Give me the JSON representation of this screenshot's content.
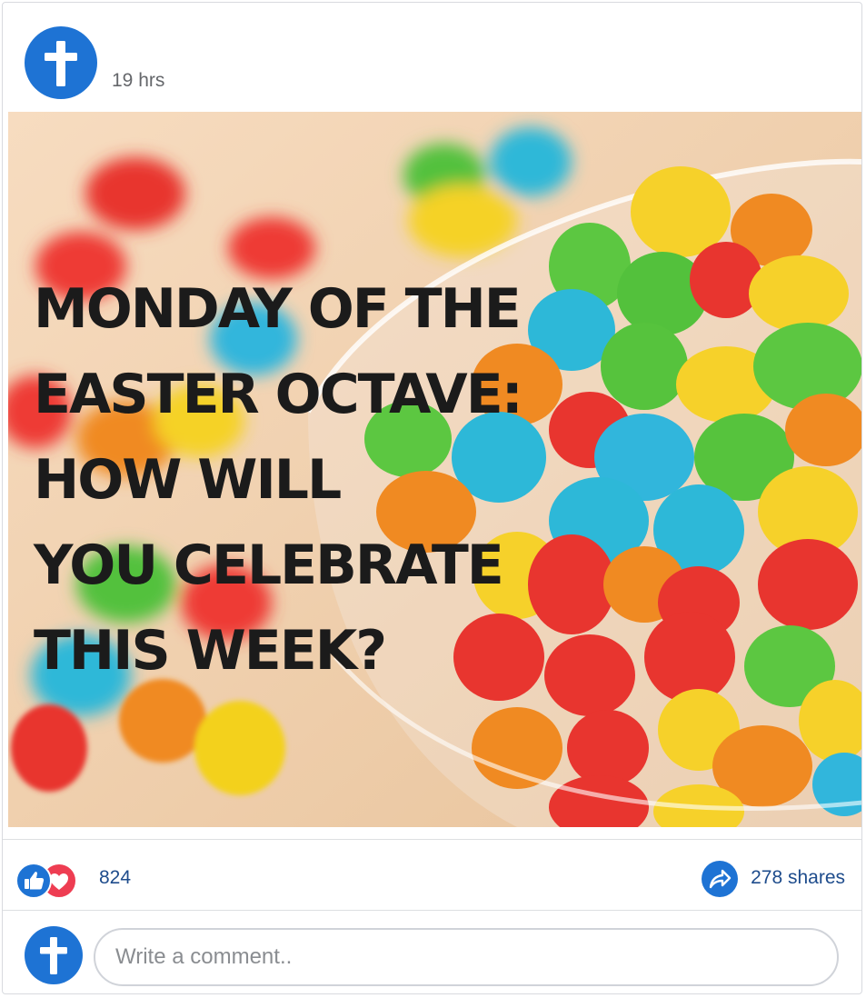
{
  "post": {
    "author_avatar_icon": "cross-icon",
    "timestamp": "19 hrs",
    "image": {
      "headline_lines": [
        "MONDAY OF THE",
        "EASTER OCTAVE:",
        "HOW WILL",
        "YOU CELEBRATE",
        "THIS WEEK?"
      ],
      "description": "bowl of colorful jelly beans"
    },
    "reactions": {
      "icons": [
        "thumbs-up-icon",
        "heart-icon"
      ],
      "count": "824"
    },
    "shares": {
      "icon": "share-arrow-icon",
      "label": "278 shares"
    }
  },
  "comment": {
    "avatar_icon": "cross-icon",
    "placeholder": "Write a comment.."
  },
  "colors": {
    "brand_blue": "#1e73d4",
    "love_red": "#ee3d52",
    "link_text": "#1e4c8c",
    "muted_text": "#65676b"
  }
}
